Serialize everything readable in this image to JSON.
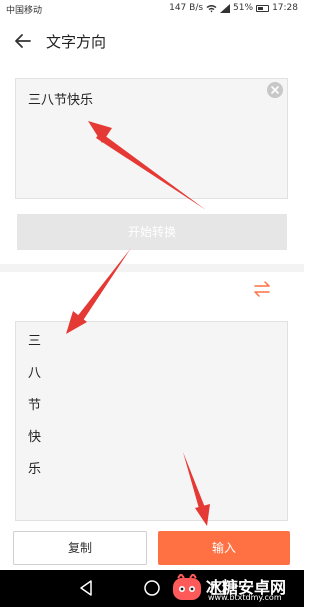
{
  "status_bar": {
    "carrier": "中国移动",
    "network_speed": "147 B/s",
    "battery_text": "51%",
    "battery_level": 0.51,
    "time": "17:28",
    "icons": [
      "wifi-icon",
      "signal-icon",
      "battery-icon"
    ]
  },
  "app_bar": {
    "back_icon": "arrow-left-icon",
    "title": "文字方向"
  },
  "input": {
    "value": "三八节快乐",
    "clear_icon": "clear-icon"
  },
  "convert_button": {
    "label": "开始转换"
  },
  "swap_icon": "swap-arrows-icon",
  "output": {
    "chars": [
      "三",
      "八",
      "节",
      "快",
      "乐"
    ]
  },
  "bottom_bar": {
    "copy_label": "复制",
    "input_label": "输入"
  },
  "nav_bar": {
    "icons": [
      "nav-back-icon",
      "nav-home-icon",
      "nav-recent-icon"
    ]
  },
  "watermark": {
    "title": "冰糖安卓网",
    "url": "www.btxtdmy.com"
  },
  "colors": {
    "accent": "#ff7043",
    "annotation_arrow": "#e53935",
    "disabled_button": "#e6e6e6",
    "panel_bg": "#f5f5f5"
  }
}
